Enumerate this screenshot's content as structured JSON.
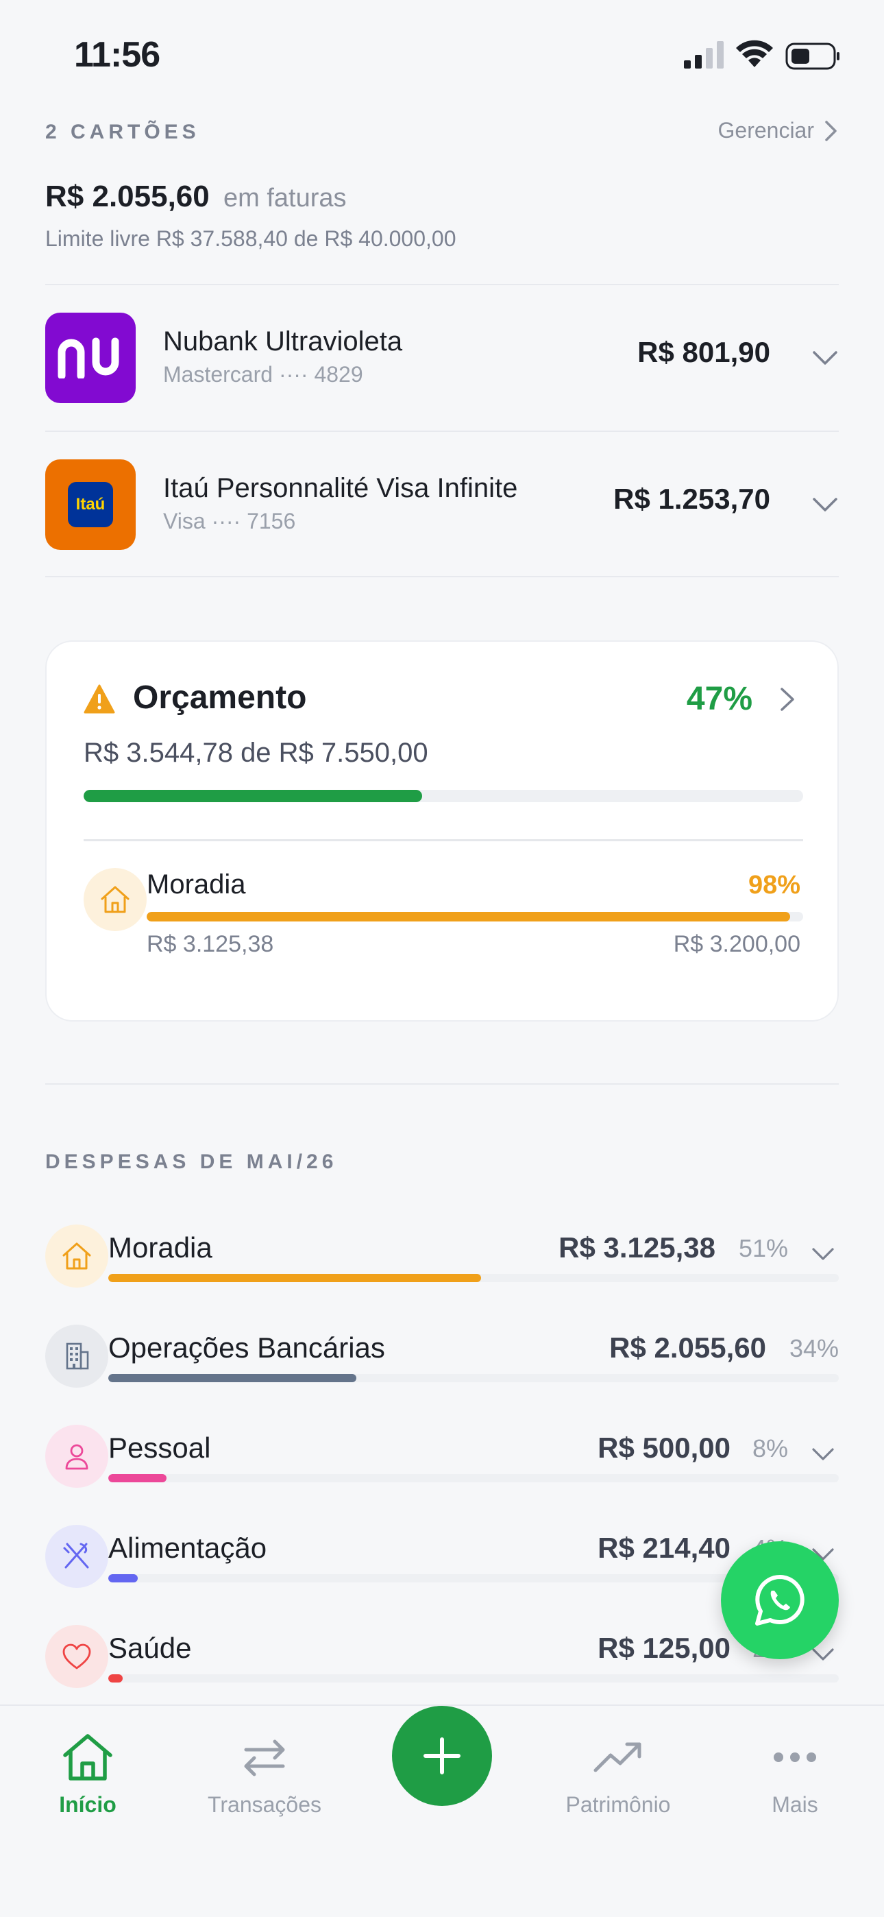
{
  "status_bar": {
    "time": "11:56"
  },
  "cards_summary": {
    "count_label": "2 CARTÕES",
    "manage_label": "Gerenciar",
    "total_amount": "R$ 2.055,60",
    "total_suffix": "em faturas",
    "limit_text": "Limite livre R$ 37.588,40 de R$ 40.000,00"
  },
  "cards": [
    {
      "name": "Nubank Ultravioleta",
      "network": "Mastercard ···· 4829",
      "amount": "R$ 801,90",
      "logo_text": "nu",
      "logo_color": "#820ad1"
    },
    {
      "name": "Itaú Personnalité Visa Infinite",
      "network": "Visa ···· 7156",
      "amount": "R$ 1.253,70",
      "logo_text": "Itaú",
      "logo_color": "#ec7000"
    }
  ],
  "budget": {
    "title": "Orçamento",
    "percent_label": "47%",
    "progress": 0.47,
    "amount_text": "R$ 3.544,78 de R$ 7.550,00",
    "category": {
      "name": "Moradia",
      "percent_label": "98%",
      "progress": 0.98,
      "spent": "R$ 3.125,38",
      "limit": "R$ 3.200,00",
      "icon": "home-icon"
    }
  },
  "expenses": {
    "title": "DESPESAS DE MAI/26",
    "items": [
      {
        "name": "Moradia",
        "amount": "R$ 3.125,38",
        "percent": "51%",
        "share": 0.51,
        "color": "#f0a01a",
        "icon_bg": "#fdf1dc",
        "icon": "home-icon",
        "expandable": true
      },
      {
        "name": "Operações Bancárias",
        "amount": "R$ 2.055,60",
        "percent": "34%",
        "share": 0.34,
        "color": "#64748b",
        "icon_bg": "#e8eaee",
        "icon": "building-icon",
        "expandable": false
      },
      {
        "name": "Pessoal",
        "amount": "R$ 500,00",
        "percent": "8%",
        "share": 0.08,
        "color": "#ec4899",
        "icon_bg": "#fbe3ee",
        "icon": "person-icon",
        "expandable": true
      },
      {
        "name": "Alimentação",
        "amount": "R$ 214,40",
        "percent": "4%",
        "share": 0.04,
        "color": "#6366f1",
        "icon_bg": "#e6e7fb",
        "icon": "utensils-icon",
        "expandable": true
      },
      {
        "name": "Saúde",
        "amount": "R$ 125,00",
        "percent": "2%",
        "share": 0.02,
        "color": "#ef4444",
        "icon_bg": "#fbe4e4",
        "icon": "heart-icon",
        "expandable": true
      }
    ]
  },
  "tabbar": {
    "items": [
      {
        "label": "Início",
        "icon": "home-icon",
        "active": true
      },
      {
        "label": "Transações",
        "icon": "transfer-icon",
        "active": false
      },
      {
        "label": "Patrimônio",
        "icon": "trend-up-icon",
        "active": false
      },
      {
        "label": "Mais",
        "icon": "more-icon",
        "active": false
      }
    ],
    "add_icon": "plus-icon"
  },
  "colors": {
    "accent": "#1f9d45",
    "warning": "#f0a01a",
    "whatsapp": "#25d366"
  }
}
